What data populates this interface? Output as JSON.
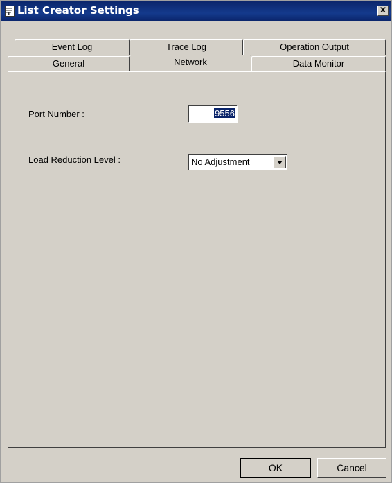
{
  "window": {
    "title": "List Creator Settings",
    "close_label": "x"
  },
  "tabs": {
    "row1": [
      "Event Log",
      "Trace Log",
      "Operation Output"
    ],
    "row2": [
      "General",
      "Network",
      "Data Monitor"
    ],
    "active": "Network"
  },
  "network": {
    "port_label_mnemonic": "P",
    "port_label_rest": "ort Number :",
    "port_value": "9556",
    "load_label_mnemonic": "L",
    "load_label_rest": "oad Reduction Level :",
    "load_value": "No Adjustment"
  },
  "buttons": {
    "ok": "OK",
    "cancel": "Cancel"
  }
}
